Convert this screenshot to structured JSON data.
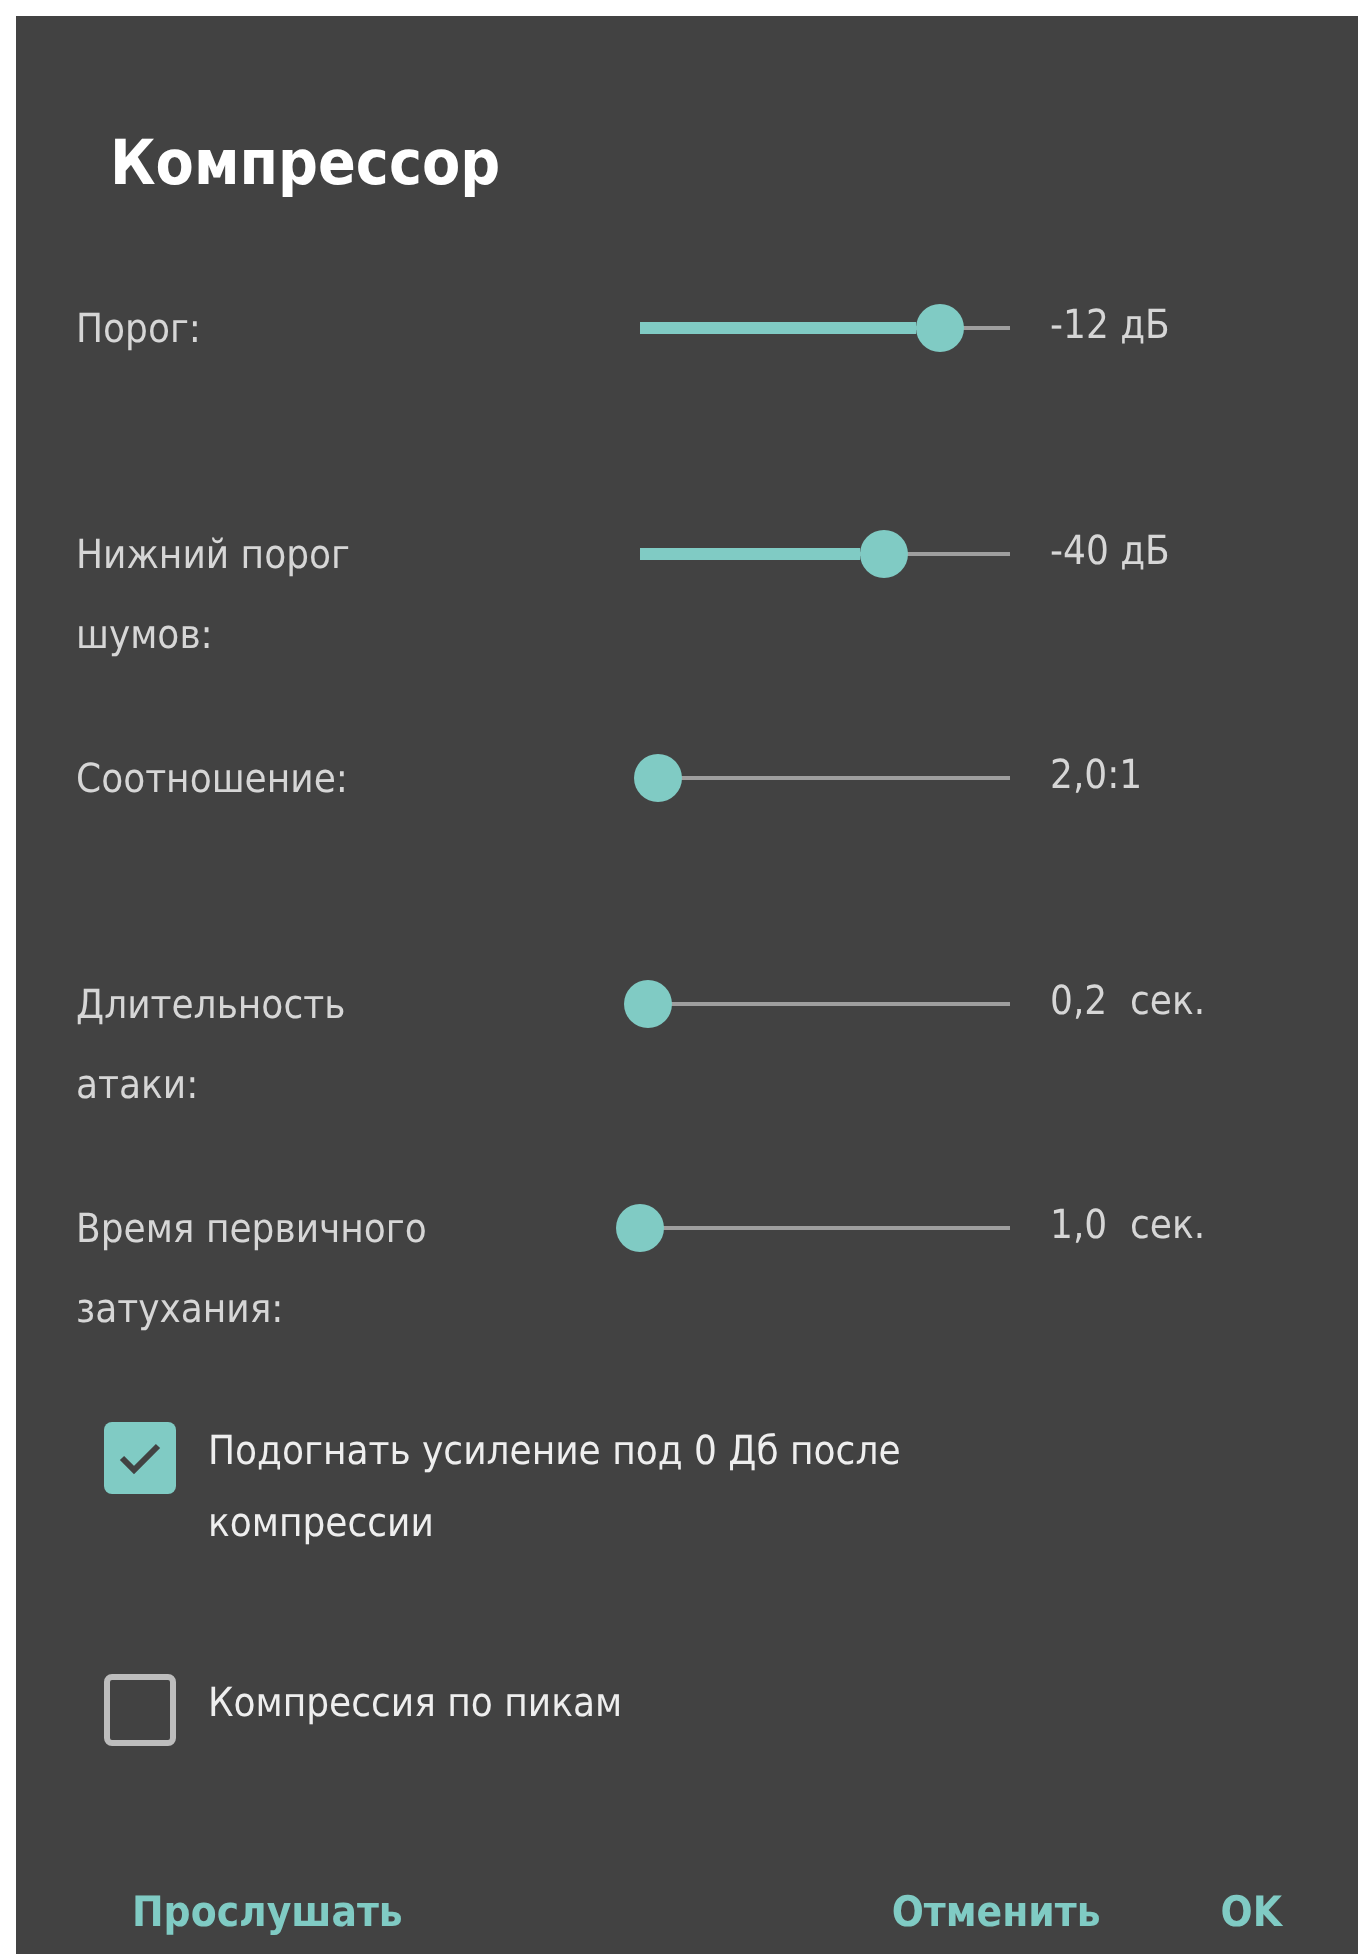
{
  "dialog": {
    "title": "Компрессор"
  },
  "sliders": [
    {
      "label": "Порог:",
      "level": 0.81,
      "reading": "-12 дБ"
    },
    {
      "label": "Нижний порог шумов:",
      "level": 0.66,
      "reading": "-40 дБ"
    },
    {
      "label": "Соотношение:",
      "level": 0.05,
      "reading": "2,0:1"
    },
    {
      "label": "Длительность атаки:",
      "level": 0.02,
      "reading": "0,2  сек."
    },
    {
      "label": "Время первичного затухания:",
      "level": 0,
      "reading": "1,0  сек."
    }
  ],
  "checkboxes": [
    {
      "label": "Подогнать усиление под 0 Дб после компрессии",
      "checked": true
    },
    {
      "label": "Компрессия по пикам",
      "checked": false
    }
  ],
  "buttons": [
    {
      "label": "Прослушать",
      "kind": "left"
    },
    {
      "label": "Отменить",
      "kind": "right"
    },
    {
      "label": "OK",
      "kind": "right"
    }
  ]
}
